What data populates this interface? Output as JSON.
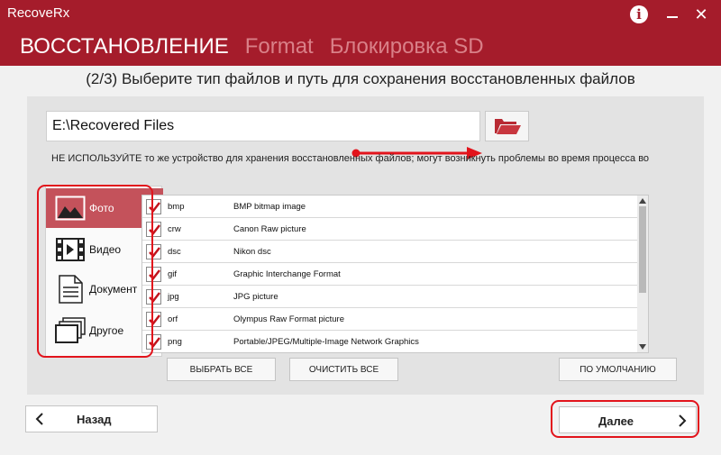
{
  "app": {
    "title": "RecoveRx"
  },
  "window": {
    "info_icon": "info-icon",
    "minimize_icon": "minimize-icon",
    "close_icon": "close-icon",
    "close_glyph": "✕"
  },
  "nav": {
    "tabs": [
      {
        "label": "ВОССТАНОВЛЕНИЕ",
        "active": true
      },
      {
        "label": "Format",
        "active": false
      },
      {
        "label": "Блокировка SD",
        "active": false
      }
    ]
  },
  "step": {
    "title": "(2/3) Выберите тип файлов и путь для сохранения восстановленных файлов"
  },
  "path": {
    "value": "E:\\Recovered Files",
    "folder_icon": "folder-open-icon"
  },
  "warning": {
    "text": "НЕ ИСПОЛЬЗУЙТЕ то же устройство для хранения восстановленных файлов; могут возникнуть проблемы во время процесса во"
  },
  "categories": [
    {
      "label": "Фото",
      "icon": "photo-icon",
      "active": true
    },
    {
      "label": "Видео",
      "icon": "video-icon",
      "active": false
    },
    {
      "label": "Документ",
      "icon": "document-icon",
      "active": false
    },
    {
      "label": "Другое",
      "icon": "other-icon",
      "active": false
    }
  ],
  "files": [
    {
      "ext": "bmp",
      "desc": "BMP bitmap image",
      "checked": true
    },
    {
      "ext": "crw",
      "desc": "Canon Raw picture",
      "checked": true
    },
    {
      "ext": "dsc",
      "desc": "Nikon dsc",
      "checked": true
    },
    {
      "ext": "gif",
      "desc": "Graphic Interchange Format",
      "checked": true
    },
    {
      "ext": "jpg",
      "desc": "JPG picture",
      "checked": true
    },
    {
      "ext": "orf",
      "desc": "Olympus Raw Format picture",
      "checked": true
    },
    {
      "ext": "png",
      "desc": "Portable/JPEG/Multiple-Image Network Graphics",
      "checked": true
    }
  ],
  "buttons": {
    "select_all": "ВЫБРАТЬ ВСЕ",
    "clear_all": "ОЧИСТИТЬ ВСЕ",
    "default": "ПО УМОЛЧАНИЮ",
    "back": "Назад",
    "next": "Далее"
  },
  "colors": {
    "brand": "#a51c2b",
    "active_category": "#c4525b",
    "annotation": "#e2141c",
    "check": "#c0141c"
  }
}
